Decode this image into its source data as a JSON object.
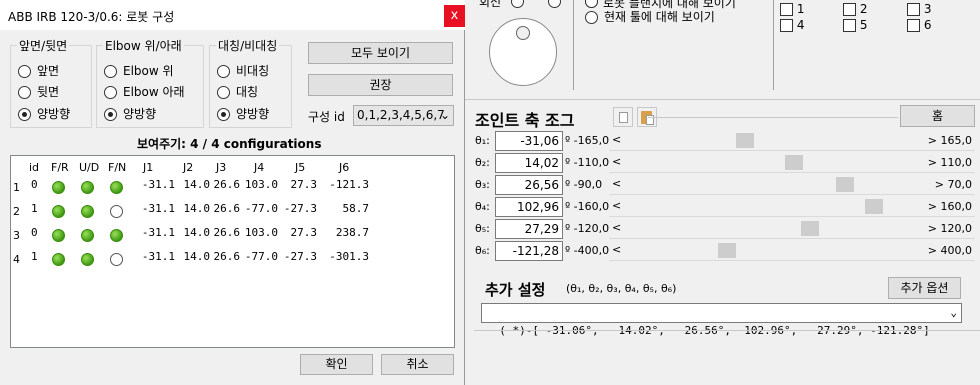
{
  "dialog": {
    "title": "ABB IRB 120-3/0.6: 로봇 구성",
    "close": "x",
    "groups": [
      {
        "label": "앞면/뒷면",
        "options": [
          "앞면",
          "뒷면",
          "양방향"
        ],
        "selected": 2
      },
      {
        "label": "Elbow 위/아래",
        "options": [
          "Elbow 위",
          "Elbow 아래",
          "양방향"
        ],
        "selected": 2
      },
      {
        "label": "대칭/비대칭",
        "options": [
          "비대칭",
          "대칭",
          "양방향"
        ],
        "selected": 2
      }
    ],
    "show_all_btn": "모두 보이기",
    "recommend_btn": "권장",
    "config_id_label": "구성 id",
    "config_id_value": "0,1,2,3,4,5,6,7",
    "summary": "보여주기: 4 / 4 configurations",
    "table": {
      "headers": [
        "id",
        "F/R",
        "U/D",
        "F/N",
        "J1",
        "J2",
        "J3",
        "J4",
        "J5",
        "J6"
      ],
      "rows": [
        {
          "num": "1",
          "id": "0",
          "fr": true,
          "ud": true,
          "fn": true,
          "j": [
            "-31.1",
            "14.0",
            "26.6",
            "103.0",
            "27.3",
            "-121.3"
          ]
        },
        {
          "num": "2",
          "id": "1",
          "fr": true,
          "ud": true,
          "fn": false,
          "j": [
            "-31.1",
            "14.0",
            "26.6",
            "-77.0",
            "-27.3",
            "58.7"
          ]
        },
        {
          "num": "3",
          "id": "0",
          "fr": true,
          "ud": true,
          "fn": true,
          "j": [
            "-31.1",
            "14.0",
            "26.6",
            "103.0",
            "27.3",
            "238.7"
          ]
        },
        {
          "num": "4",
          "id": "1",
          "fr": true,
          "ud": true,
          "fn": false,
          "j": [
            "-31.1",
            "14.0",
            "26.6",
            "-77.0",
            "-27.3",
            "-301.3"
          ]
        }
      ]
    },
    "ok_btn": "확인",
    "cancel_btn": "취소"
  },
  "bg": {
    "top_radio_1": "현재 툴에 대해 보이기",
    "checkboxes": [
      "1",
      "2",
      "3",
      "4",
      "5",
      "6"
    ],
    "jog_title": "조인트 축 조그",
    "home_btn": "홈",
    "joints": [
      {
        "label": "θ₁:",
        "value": "-31,06",
        "min": "º -165,0",
        "max": "> 165,0",
        "frac": 0.406
      },
      {
        "label": "θ₂:",
        "value": "14,02",
        "min": "º -110,0",
        "max": "> 110,0",
        "frac": 0.564
      },
      {
        "label": "θ₃:",
        "value": "26,56",
        "min": "º -90,0",
        "max": "> 70,0",
        "frac": 0.729
      },
      {
        "label": "θ₄:",
        "value": "102,96",
        "min": "º -160,0",
        "max": "> 160,0",
        "frac": 0.822
      },
      {
        "label": "θ₅:",
        "value": "27,29",
        "min": "º -120,0",
        "max": "> 120,0",
        "frac": 0.614
      },
      {
        "label": "θ₆:",
        "value": "-121,28",
        "min": "º -400,0",
        "max": "> 400,0",
        "frac": 0.348
      }
    ],
    "extra_title": "추가 설정",
    "extra_sub": "(θ₁, θ₂, θ₃, θ₄, θ₅, θ₆)",
    "extra_btn": "추가 옵션",
    "combo_value": "( *)-[ -31.06°,   14.02°,   26.56°,  102.96°,   27.29°, -121.28°]"
  }
}
